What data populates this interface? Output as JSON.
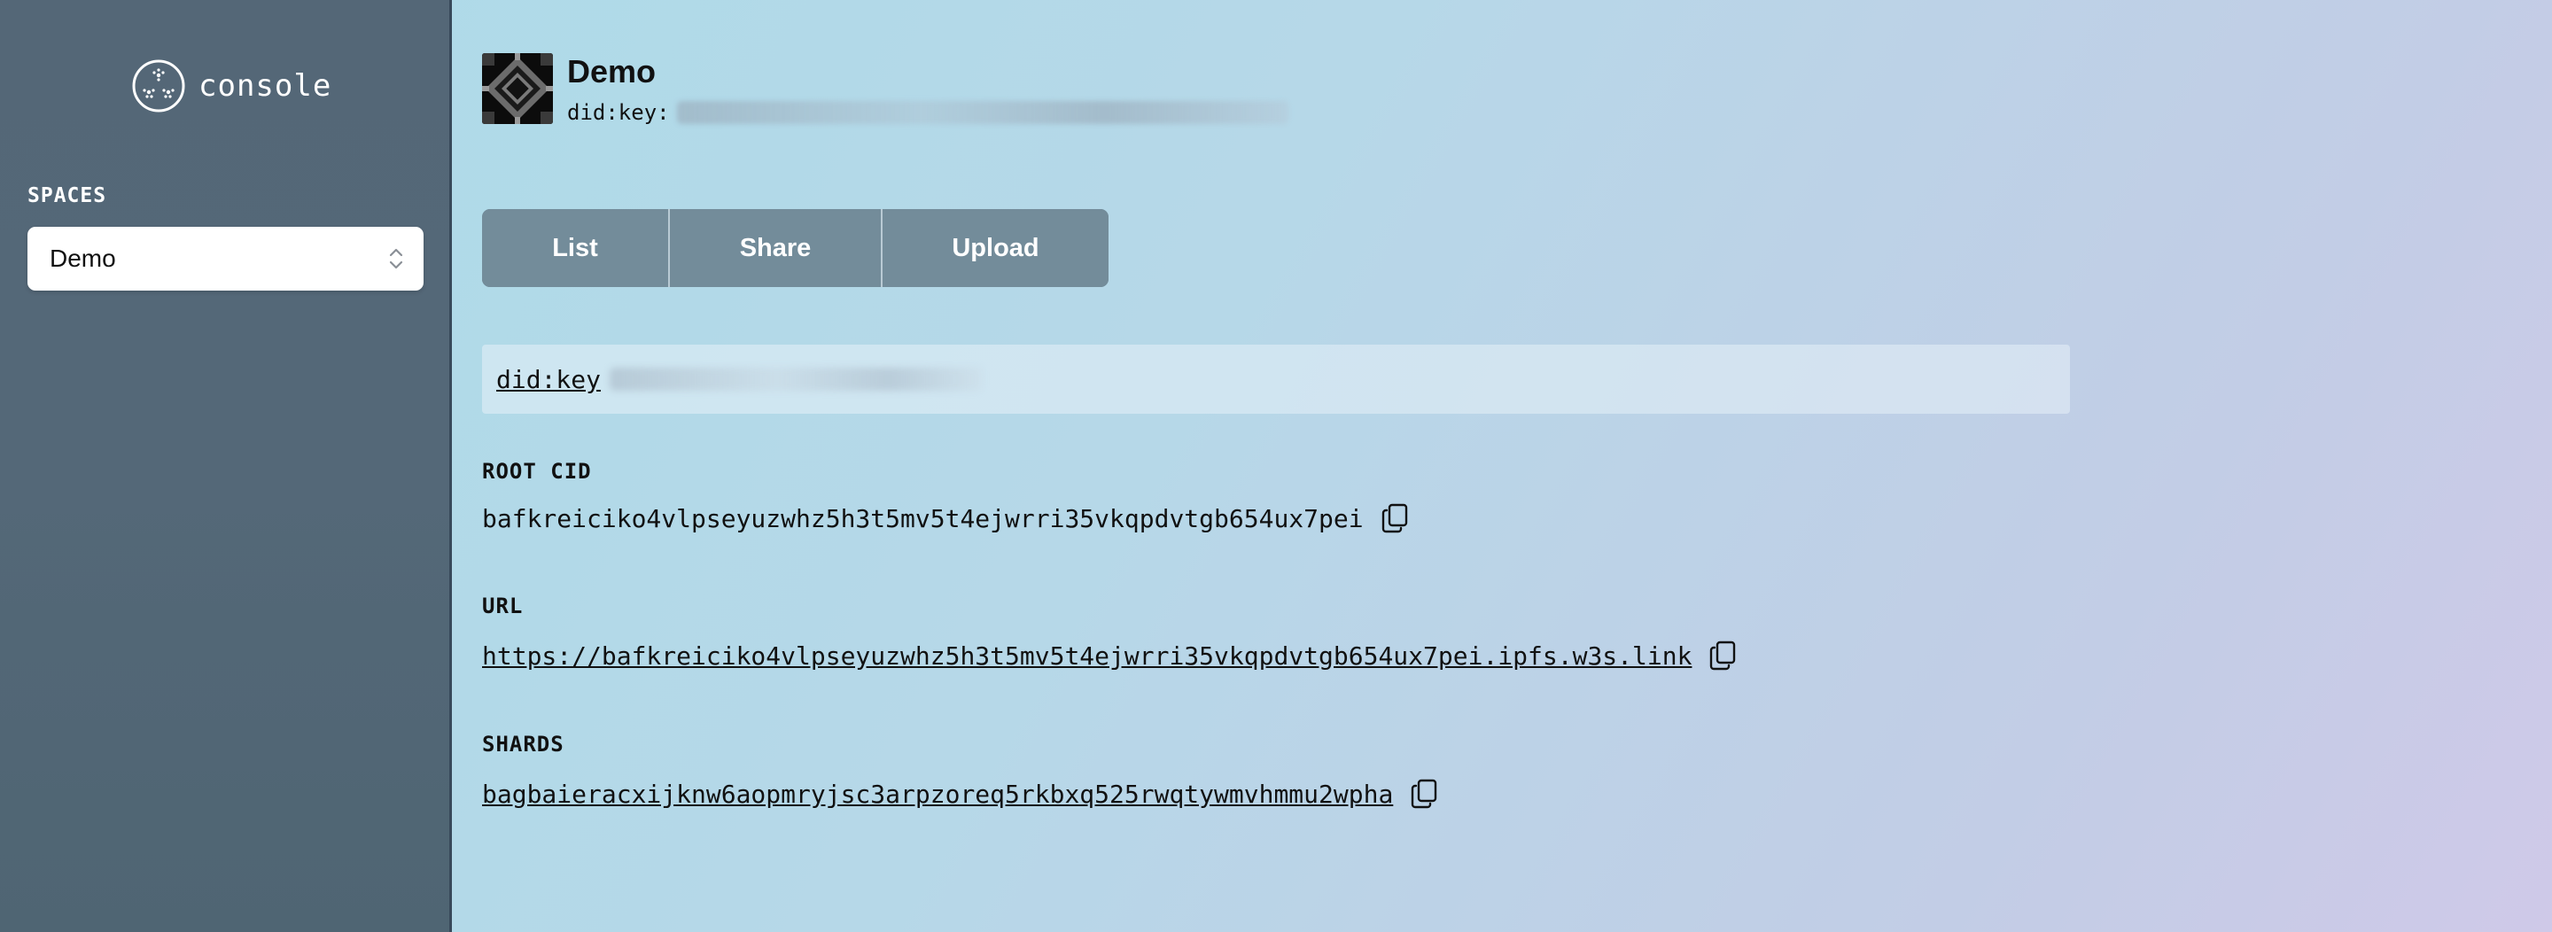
{
  "sidebar": {
    "logo_text": "console",
    "spaces_label": "SPACES",
    "selected_space": "Demo"
  },
  "header": {
    "space_name": "Demo",
    "did_prefix": "did:key:"
  },
  "tabs": [
    {
      "label": "List"
    },
    {
      "label": "Share"
    },
    {
      "label": "Upload"
    }
  ],
  "did_bar": {
    "link_text": "did:key"
  },
  "details": {
    "root_cid": {
      "label": "ROOT CID",
      "value": "bafkreiciko4vlpseyuzwhz5h3t5mv5t4ejwrri35vkqpdvtgb654ux7pei"
    },
    "url": {
      "label": "URL",
      "value": "https://bafkreiciko4vlpseyuzwhz5h3t5mv5t4ejwrri35vkqpdvtgb654ux7pei.ipfs.w3s.link"
    },
    "shards": {
      "label": "SHARDS",
      "value": "bagbaieracxijknw6aopmryjsc3arpzoreq5rkbxq525rwqtywmvhmmu2wpha"
    }
  },
  "icons": {
    "logo": "snowflake-logo-icon",
    "select": "chevron-up-down-icon",
    "copy": "copy-icon"
  },
  "colors": {
    "sidebar_bg": "#546777",
    "tab_bg": "#738c9a",
    "text": "#111111"
  }
}
